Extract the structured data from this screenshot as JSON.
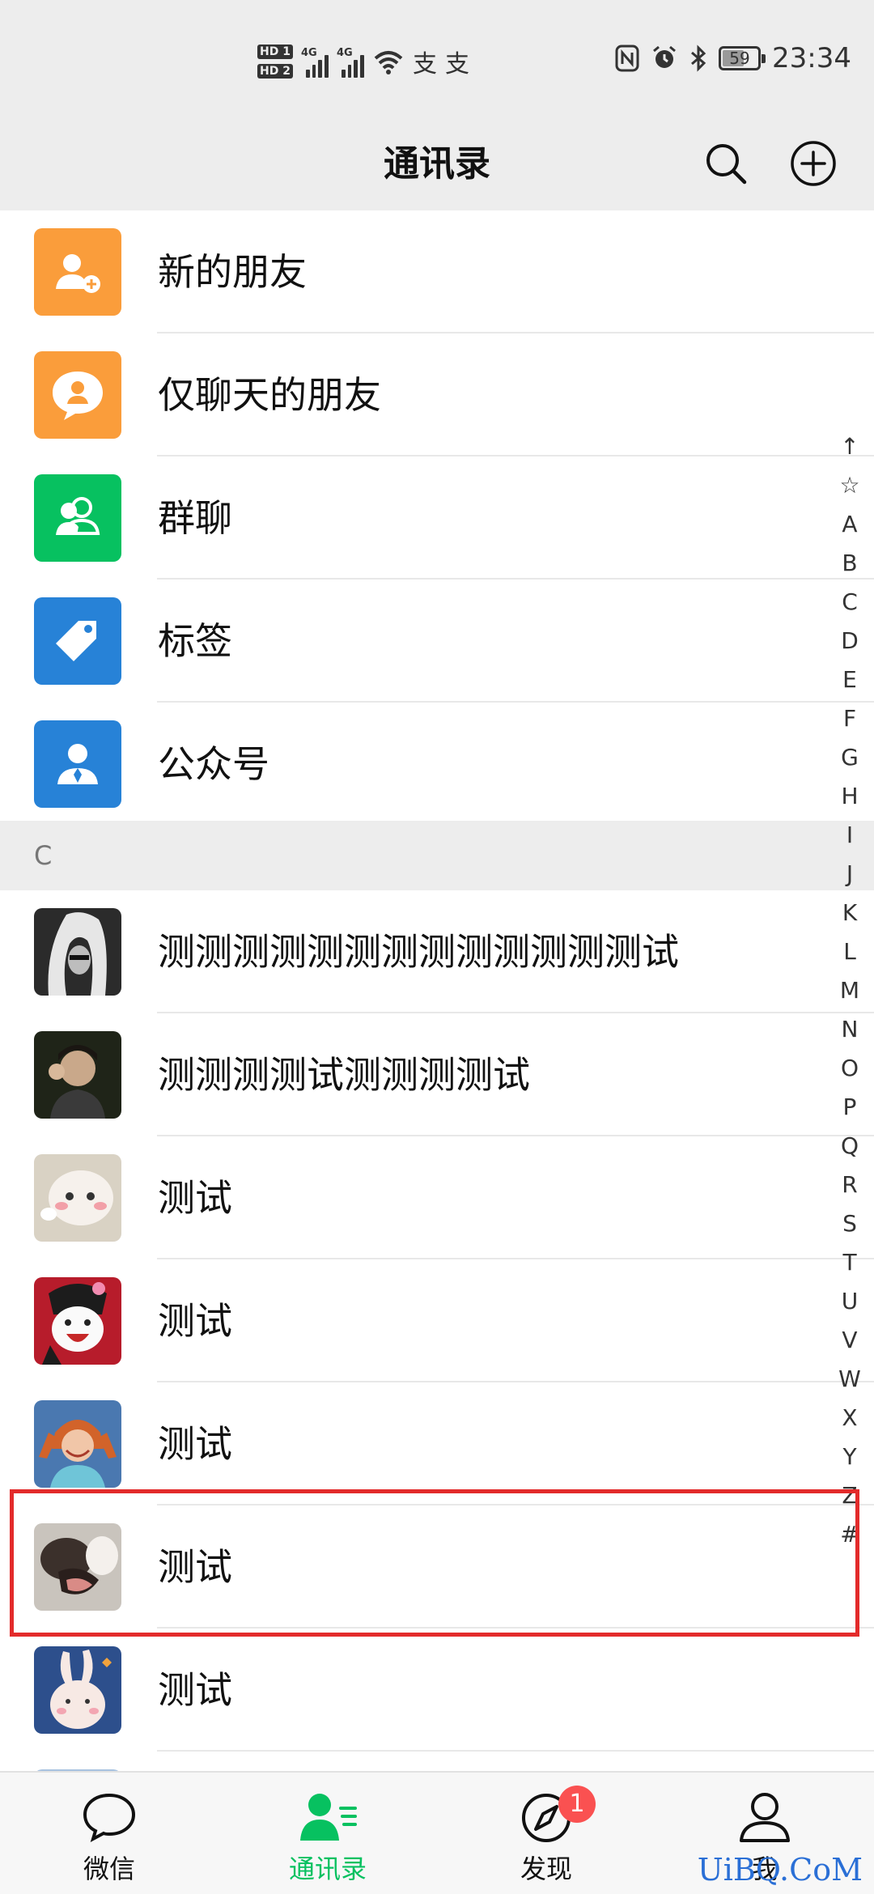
{
  "status_bar": {
    "hd1": "HD 1",
    "hd2": "HD 2",
    "network1": "4G",
    "network2": "4G",
    "battery": "59",
    "time": "23:34"
  },
  "header": {
    "title": "通讯录"
  },
  "function_items": [
    {
      "label": "新的朋友",
      "color": "#fa9d3b",
      "icon": "add-user-icon"
    },
    {
      "label": "仅聊天的朋友",
      "color": "#fa9d3b",
      "icon": "chat-only-friend-icon"
    },
    {
      "label": "群聊",
      "color": "#07c160",
      "icon": "group-chat-icon"
    },
    {
      "label": "标签",
      "color": "#2782d7",
      "icon": "tag-icon"
    },
    {
      "label": "公众号",
      "color": "#2782d7",
      "icon": "official-account-icon"
    }
  ],
  "section_header": "C",
  "contacts": [
    {
      "name": "测测测测测测测测测测测测测试"
    },
    {
      "name": "测测测测试测测测测试"
    },
    {
      "name": "测试"
    },
    {
      "name": "测试"
    },
    {
      "name": "测试"
    },
    {
      "name": "测试"
    },
    {
      "name": "测试"
    }
  ],
  "index_bar": [
    "↑",
    "☆",
    "A",
    "B",
    "C",
    "D",
    "E",
    "F",
    "G",
    "H",
    "I",
    "J",
    "K",
    "L",
    "M",
    "N",
    "O",
    "P",
    "Q",
    "R",
    "S",
    "T",
    "U",
    "V",
    "W",
    "X",
    "Y",
    "Z",
    "#"
  ],
  "bottom_nav": [
    {
      "label": "微信",
      "icon": "chat-bubble-icon",
      "active": false
    },
    {
      "label": "通讯录",
      "icon": "contacts-icon",
      "active": true
    },
    {
      "label": "发现",
      "icon": "compass-icon",
      "active": false,
      "badge": "1"
    },
    {
      "label": "我",
      "icon": "person-icon",
      "active": false
    }
  ],
  "watermark": "UiBQ.CoM",
  "colors": {
    "accent": "#07c160",
    "highlight": "#e32b2b",
    "badge": "#fa5151"
  }
}
